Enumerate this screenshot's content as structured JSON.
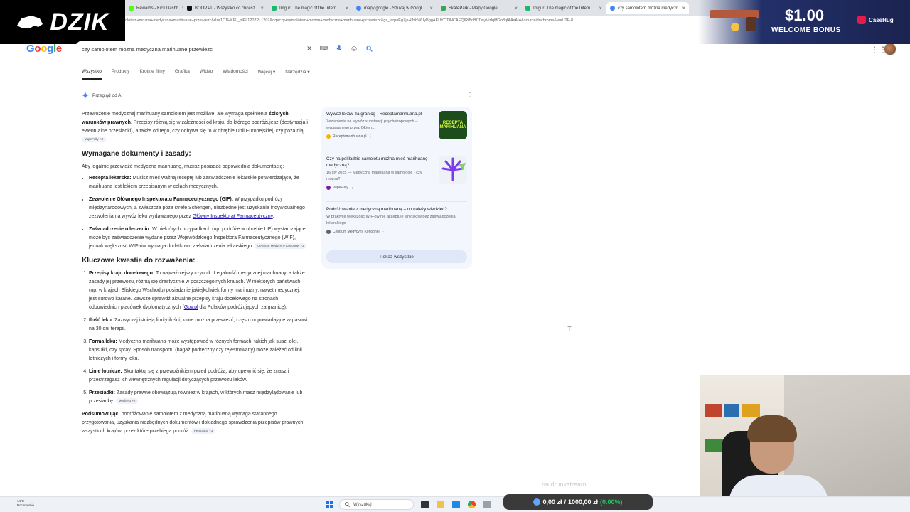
{
  "browser": {
    "tabs": [
      {
        "label": "Rewards - Kick Dashb",
        "color": "#53fc18",
        "active": false
      },
      {
        "label": "BOOP.PL - Wszystko co chcesz",
        "color": "#111111",
        "active": false
      },
      {
        "label": "Imgur: The magic of the Intern",
        "color": "#1bb76e",
        "active": false
      },
      {
        "label": "mapy google - Szukaj w Googl",
        "color": "#4285f4",
        "active": false
      },
      {
        "label": "SkatePark - Mapy Google",
        "color": "#34a853",
        "active": false
      },
      {
        "label": "Imgur: The magic of the Intern",
        "color": "#1bb76e",
        "active": false
      },
      {
        "label": "czy samolotem mozna medyczn",
        "color": "#4285f4",
        "active": true
      }
    ],
    "url": "olotem+mozna+medyczna+marihuane+przewiezc&rlz=1C1HKFL_plPL1207PL1207&oq=czy+samolotem+mozna+medyczna+marihuane+przewiezc&gs_lcrp=EgZjaHJvbWUyBggAEUYOTIHCAEQIRiBdBCDcyMzIqMGo3qlAAsAIA&sourceid=chrome&ie=UTF-8"
  },
  "logo_overlay": {
    "text": "DZIK"
  },
  "google": {
    "logo": "Google",
    "query": "czy samolotem mozna medyczna marihuane przewiezc",
    "nav": [
      "Wszystko",
      "Produkty",
      "Krótkie filmy",
      "Grafika",
      "Wideo",
      "Wiadomości",
      "Więcej ▾",
      "Narzędzia ▾"
    ]
  },
  "ai_overview": {
    "header": "Przegląd od AI",
    "intro_a": "Przewożenie medycznej marihuany samolotem jest możliwe, ale wymaga spełnienia ",
    "intro_b": "ścisłych warunków prawnych",
    "intro_c": ". Przepisy różnią się w zależności od kraju, do którego podróżujesz (destynacja i ewentualne przesiadki), a także od tego, czy odbywa się to w obrębie Unii Europejskiej, czy poza nią.",
    "intro_chip": "VapeFully +3",
    "h_docs": "Wymagane dokumenty i zasady:",
    "docs_intro": "Aby legalnie przewieźć medyczną marihuanę, musisz posiadać odpowiednią dokumentację:",
    "docs": [
      {
        "b": "Recepta lekarska:",
        "t": " Musisz mieć ważną receptę lub zaświadczenie lekarskie potwierdzające, że marihuana jest lekiem przepisanym w celach medycznych."
      },
      {
        "b": "Zezwolenie Głównego Inspektoratu Farmaceutycznego (GIF):",
        "t": " W przypadku podróży międzynarodowych, a zwłaszcza poza strefę Schengen, niezbędne jest uzyskanie indywidualnego zezwolenia na wywóz leku wydawanego przez ",
        "link": "Główny Inspektorat Farmaceutyczny",
        "tail": "."
      },
      {
        "b": "Zaświadczenie o leczeniu:",
        "t": " W niektórych przypadkach (np. podróże w obrębie UE) wystarczające może być zaświadczenie wydane przez Wojewódzkiego Inspektora Farmaceutycznego (WIF), jednak większość WIF-ów wymaga dodatkowo zaświadczenia lekarskiego.",
        "chip": "Centrum Medycyny Konopnej +3"
      }
    ],
    "h_key": "Kluczowe kwestie do rozważenia:",
    "key": [
      {
        "b": "Przepisy kraju docelowego:",
        "t": " To najważniejszy czynnik. Legalność medycznej marihuany, a także zasady jej przewozu, różnią się drastycznie w poszczególnych krajach. W niektórych państwach (np. w krajach Bliskiego Wschodu) posiadanie jakiejkolwiek formy marihuany, nawet medycznej, jest surowo karane. Zawsze sprawdź aktualne przepisy kraju docelowego na stronach odpowiednich placówek dyplomatycznych (",
        "link": "Gov.pl",
        "tail": " dla Polaków podróżujących za granicę)."
      },
      {
        "b": "Ilość leku:",
        "t": " Zazwyczaj istnieją limity ilości, które można przewieźć, często odpowiadające zapasowi na 30 dni terapii."
      },
      {
        "b": "Forma leku:",
        "t": " Medyczna marihuana może występować w różnych formach, takich jak susz, olej, kapsułki, czy spray. Sposób transportu (bagaż podręczny czy rejestrowany) może zależeć od linii lotniczych i formy leku."
      },
      {
        "b": "Linie lotnicze:",
        "t": " Skontaktuj się z przewoźnikiem przed podróżą, aby upewnić się, że znasz i przestrzegasz ich wewnętrznych regulacji dotyczących przewozu leków."
      },
      {
        "b": "Przesiadki:",
        "t": " Zasady prawne obowiązują również w krajach, w których masz międzylądowanie lub przesiadkę.",
        "chip": "Medirest +2"
      }
    ],
    "summary_b": "Podsumowując:",
    "summary_t": " podróżowanie samolotem z medyczną marihuaną wymaga starannego przygotowania, uzyskania niezbędnych dokumentów i dokładnego sprawdzenia przepisów prawnych wszystkich krajów, przez które przebiega podróż.",
    "summary_chip": "Hempio.pl +3"
  },
  "sources": {
    "items": [
      {
        "title": "Wywóz leków za granicę - Receptamarihuana.pl",
        "desc": "Zezwolenia na wywóz substancji psychotropowych -- wydawanego przez Główn...",
        "site": "Receptamarihuana.pl",
        "thumb_text": "RECEPTA MARIHUANA",
        "dot": "#f4b400"
      },
      {
        "title": "Czy na pokładzie samolotu można mieć marihuanę medyczną?",
        "desc": "16 sty 2025 — Medyczna marihuana w samolocie - czy można?",
        "site": "VapeFully",
        "thumb_text": "",
        "dot": "#7b1fa2"
      },
      {
        "title": "Podróżowanie z medyczną marihuaną – co należy wiedzieć?",
        "desc": "W praktyce większość WIF-ów nie akceptuje wniosków bez zaświadczenia lekarskiego",
        "site": "Centrum Medycyny Konopnej",
        "thumb_text": "",
        "dot": "#5f6368"
      }
    ],
    "show_all": "Pokaż wszystkie"
  },
  "taskbar": {
    "weather_temp": "14°C",
    "weather_desc": "Pochmurnie",
    "search": "Wyszukaj"
  },
  "stream": {
    "bonus_amount": "$1.00",
    "bonus_label": "WELCOME BONUS",
    "bonus_brand": "CaseHug",
    "balance_left": "0,00 zł",
    "balance_mid": "1000,00 zł",
    "balance_pct": "(0.00%)",
    "watermark": "na drunkstream"
  }
}
